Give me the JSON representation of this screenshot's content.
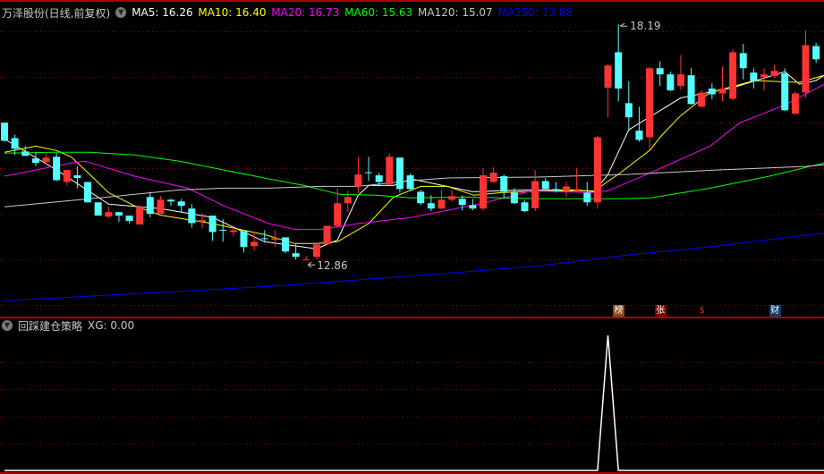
{
  "header": {
    "title": "万泽股份(日线,前复权)",
    "ma_labels": [
      {
        "text": "MA5: 16.26",
        "color": "#ffffff"
      },
      {
        "text": "MA10: 16.40",
        "color": "#ffff00"
      },
      {
        "text": "MA20: 16.73",
        "color": "#ff00ff"
      },
      {
        "text": "MA60: 15.63",
        "color": "#00ff00"
      },
      {
        "text": "MA120: 15.07",
        "color": "#c8c8c8"
      },
      {
        "text": "MA250: 13.88",
        "color": "#0000ff"
      }
    ]
  },
  "annotations": {
    "high_label": "18.19",
    "low_label": "12.86"
  },
  "event_markers": [
    {
      "index": 59,
      "text": "榜",
      "bg": "#8a4a10",
      "color": "#ffffff"
    },
    {
      "index": 63,
      "text": "张",
      "bg": "#7a0000",
      "color": "#ffffff"
    },
    {
      "index": 67,
      "text": "$",
      "bg": "transparent",
      "color": "#ff2020"
    },
    {
      "index": 74,
      "text": "财",
      "bg": "#103a6e",
      "color": "#ffffff"
    }
  ],
  "indicator": {
    "title": "回踩建仓策略",
    "value_label": "XG: 0.00"
  },
  "colors": {
    "up": "#ff3333",
    "down": "#54ffff",
    "grid": "#a00000",
    "border": "#b00000"
  },
  "chart_data": [
    {
      "type": "candlestick",
      "title": "万泽股份(日线,前复权)",
      "ylim": [
        11.63,
        18.74
      ],
      "grid": true,
      "ohlc": [
        [
          15.97,
          15.56,
          15.97,
          15.54
        ],
        [
          15.62,
          15.38,
          15.7,
          15.24
        ],
        [
          15.32,
          15.22,
          15.44,
          15.22
        ],
        [
          15.16,
          15.06,
          15.3,
          14.99
        ],
        [
          15.08,
          15.18,
          15.26,
          15.02
        ],
        [
          15.2,
          14.67,
          15.28,
          14.65
        ],
        [
          14.63,
          14.9,
          14.9,
          14.55
        ],
        [
          14.78,
          14.72,
          14.99,
          14.49
        ],
        [
          14.63,
          14.17,
          14.63,
          14.17
        ],
        [
          14.17,
          13.87,
          14.17,
          13.87
        ],
        [
          13.85,
          13.95,
          14.07,
          13.81
        ],
        [
          13.95,
          13.87,
          13.95,
          13.73
        ],
        [
          13.87,
          13.75,
          13.87,
          13.69
        ],
        [
          13.67,
          14.07,
          14.11,
          13.67
        ],
        [
          14.29,
          13.91,
          14.41,
          13.83
        ],
        [
          13.91,
          14.23,
          14.31,
          13.91
        ],
        [
          14.23,
          14.19,
          14.25,
          14.09
        ],
        [
          14.19,
          14.09,
          14.25,
          13.93
        ],
        [
          14.03,
          13.7,
          14.13,
          13.6
        ],
        [
          13.73,
          13.77,
          13.93,
          13.58
        ],
        [
          13.87,
          13.5,
          13.87,
          13.3
        ],
        [
          13.55,
          13.54,
          13.79,
          13.28
        ],
        [
          13.5,
          13.54,
          13.64,
          13.4
        ],
        [
          13.52,
          13.16,
          13.52,
          13.04
        ],
        [
          13.18,
          13.28,
          13.5,
          13.08
        ],
        [
          13.36,
          13.34,
          13.54,
          13.26
        ],
        [
          13.32,
          13.36,
          13.54,
          13.16
        ],
        [
          13.38,
          13.06,
          13.38,
          13.02
        ],
        [
          13.02,
          12.94,
          13.22,
          12.88
        ],
        [
          12.87,
          12.88,
          12.96,
          12.86
        ],
        [
          12.94,
          13.22,
          13.22,
          12.88
        ],
        [
          13.22,
          13.64,
          13.64,
          13.22
        ],
        [
          13.64,
          14.15,
          14.49,
          13.6
        ],
        [
          14.15,
          14.29,
          14.43,
          13.95
        ],
        [
          14.53,
          14.8,
          15.2,
          14.37
        ],
        [
          14.85,
          14.84,
          15.2,
          14.65
        ],
        [
          14.78,
          14.63,
          14.84,
          14.53
        ],
        [
          14.57,
          15.2,
          15.28,
          14.57
        ],
        [
          15.18,
          14.47,
          15.18,
          14.39
        ],
        [
          14.78,
          14.47,
          14.82,
          14.43
        ],
        [
          14.41,
          14.15,
          14.45,
          14.11
        ],
        [
          14.15,
          14.03,
          14.33,
          13.97
        ],
        [
          14.03,
          14.23,
          14.45,
          14.01
        ],
        [
          14.23,
          14.31,
          14.45,
          14.19
        ],
        [
          14.25,
          14.11,
          14.33,
          13.99
        ],
        [
          14.11,
          14.03,
          14.25,
          13.99
        ],
        [
          14.03,
          14.78,
          14.94,
          13.99
        ],
        [
          14.63,
          14.84,
          14.96,
          14.61
        ],
        [
          14.76,
          14.41,
          14.8,
          14.25
        ],
        [
          14.39,
          14.15,
          14.49,
          14.13
        ],
        [
          14.17,
          13.97,
          14.21,
          13.95
        ],
        [
          14.04,
          14.65,
          14.9,
          13.97
        ],
        [
          14.65,
          14.47,
          14.72,
          14.45
        ],
        [
          14.47,
          14.43,
          14.63,
          14.39
        ],
        [
          14.43,
          14.53,
          14.63,
          14.29
        ],
        [
          14.43,
          14.47,
          14.94,
          14.39
        ],
        [
          14.39,
          14.17,
          14.63,
          14.09
        ],
        [
          14.17,
          15.64,
          15.68,
          14.03
        ],
        [
          16.76,
          17.26,
          17.3,
          16.09
        ],
        [
          17.56,
          16.74,
          18.19,
          16.45
        ],
        [
          16.41,
          16.09,
          16.9,
          15.77
        ],
        [
          15.79,
          15.58,
          16.33,
          15.54
        ],
        [
          15.64,
          17.2,
          17.24,
          15.36
        ],
        [
          17.2,
          17.06,
          17.36,
          16.8
        ],
        [
          17.06,
          16.7,
          17.12,
          16.68
        ],
        [
          16.8,
          17.06,
          17.5,
          16.72
        ],
        [
          17.04,
          16.39,
          17.2,
          16.37
        ],
        [
          16.33,
          16.65,
          16.7,
          16.31
        ],
        [
          16.74,
          16.61,
          16.86,
          16.49
        ],
        [
          16.63,
          16.74,
          17.24,
          16.45
        ],
        [
          16.51,
          17.56,
          17.62,
          16.47
        ],
        [
          17.54,
          17.2,
          17.75,
          16.95
        ],
        [
          17.1,
          16.9,
          17.2,
          16.74
        ],
        [
          17.0,
          17.06,
          17.2,
          16.7
        ],
        [
          17.02,
          17.14,
          17.28,
          16.98
        ],
        [
          17.08,
          16.25,
          17.2,
          16.23
        ],
        [
          16.17,
          16.63,
          16.68,
          16.15
        ],
        [
          16.65,
          17.72,
          18.05,
          16.53
        ],
        [
          17.7,
          17.4,
          17.77,
          17.32
        ]
      ],
      "ma_series": [
        {
          "name": "MA5",
          "color": "#ffffff",
          "points": [
            [
              0,
              15.6
            ],
            [
              5,
              14.9
            ],
            [
              10,
              14.13
            ],
            [
              15,
              14.03
            ],
            [
              20,
              13.83
            ],
            [
              25,
              13.28
            ],
            [
              30,
              13.12
            ],
            [
              32,
              13.32
            ],
            [
              34,
              14.33
            ],
            [
              35,
              14.55
            ],
            [
              37.4,
              14.55
            ],
            [
              39.1,
              14.7
            ],
            [
              45,
              14.41
            ],
            [
              50,
              14.45
            ],
            [
              55,
              14.45
            ],
            [
              56.7,
              14.41
            ],
            [
              58,
              14.8
            ],
            [
              60,
              15.81
            ],
            [
              65,
              16.53
            ],
            [
              70,
              16.76
            ],
            [
              75,
              17.12
            ],
            [
              76.4,
              16.84
            ],
            [
              78,
              16.92
            ],
            [
              78.8,
              17.04
            ]
          ]
        },
        {
          "name": "MA10",
          "color": "#ffff00",
          "points": [
            [
              0,
              15.3
            ],
            [
              3,
              15.44
            ],
            [
              5,
              15.34
            ],
            [
              6.4,
              15.2
            ],
            [
              8.2,
              14.8
            ],
            [
              10,
              14.39
            ],
            [
              12.5,
              14.09
            ],
            [
              15,
              13.88
            ],
            [
              20,
              13.69
            ],
            [
              25,
              13.44
            ],
            [
              27.9,
              13.24
            ],
            [
              30,
              13.24
            ],
            [
              32,
              13.28
            ],
            [
              35,
              13.69
            ],
            [
              37.4,
              14.29
            ],
            [
              40,
              14.53
            ],
            [
              42.6,
              14.53
            ],
            [
              45.1,
              14.33
            ],
            [
              47.7,
              14.39
            ],
            [
              52,
              14.43
            ],
            [
              56.7,
              14.43
            ],
            [
              59.2,
              14.84
            ],
            [
              62.1,
              15.36
            ],
            [
              63,
              15.64
            ],
            [
              64.9,
              16.11
            ],
            [
              67.8,
              16.65
            ],
            [
              72.1,
              16.92
            ],
            [
              76.4,
              16.88
            ],
            [
              78.8,
              17.04
            ]
          ]
        },
        {
          "name": "MA20",
          "color": "#ff00ff",
          "points": [
            [
              0,
              14.76
            ],
            [
              6.4,
              15.06
            ],
            [
              7.7,
              15.1
            ],
            [
              12.5,
              14.76
            ],
            [
              17.6,
              14.49
            ],
            [
              21.1,
              14.09
            ],
            [
              25.4,
              13.69
            ],
            [
              27.9,
              13.56
            ],
            [
              30.5,
              13.56
            ],
            [
              34,
              13.69
            ],
            [
              39.1,
              13.83
            ],
            [
              46,
              14.15
            ],
            [
              50.6,
              14.43
            ],
            [
              56.3,
              14.39
            ],
            [
              58,
              14.43
            ],
            [
              62.1,
              14.84
            ],
            [
              67.8,
              15.44
            ],
            [
              70.7,
              15.97
            ],
            [
              75,
              16.37
            ],
            [
              78.8,
              16.84
            ]
          ]
        },
        {
          "name": "MA60",
          "color": "#00ff00",
          "points": [
            [
              0,
              15.28
            ],
            [
              4.7,
              15.3
            ],
            [
              8.2,
              15.3
            ],
            [
              12.5,
              15.24
            ],
            [
              16.8,
              15.1
            ],
            [
              21.1,
              14.9
            ],
            [
              25.4,
              14.7
            ],
            [
              28.8,
              14.55
            ],
            [
              32.2,
              14.35
            ],
            [
              35.7,
              14.33
            ],
            [
              39.1,
              14.27
            ],
            [
              44.3,
              14.29
            ],
            [
              51.2,
              14.25
            ],
            [
              56.3,
              14.25
            ],
            [
              59.2,
              14.25
            ],
            [
              62.1,
              14.27
            ],
            [
              67.8,
              14.49
            ],
            [
              73.5,
              14.76
            ],
            [
              78.8,
              15.06
            ]
          ]
        },
        {
          "name": "MA120",
          "color": "#c8c8c8",
          "points": [
            [
              0,
              14.07
            ],
            [
              8.2,
              14.25
            ],
            [
              16.8,
              14.45
            ],
            [
              21.1,
              14.49
            ],
            [
              25.4,
              14.49
            ],
            [
              30.5,
              14.53
            ],
            [
              34,
              14.53
            ],
            [
              39.1,
              14.66
            ],
            [
              42.6,
              14.72
            ],
            [
              51.2,
              14.74
            ],
            [
              59.8,
              14.8
            ],
            [
              68.4,
              14.9
            ],
            [
              77,
              14.98
            ],
            [
              78.8,
              15.02
            ]
          ]
        },
        {
          "name": "MA250",
          "color": "#0000ff",
          "points": [
            [
              0,
              11.95
            ],
            [
              25.4,
              12.27
            ],
            [
              42.6,
              12.57
            ],
            [
              51.2,
              12.73
            ],
            [
              59.8,
              12.98
            ],
            [
              68.4,
              13.18
            ],
            [
              78.8,
              13.48
            ]
          ]
        }
      ],
      "high_point": {
        "index": 59,
        "value": 18.19
      },
      "low_point": {
        "index": 29,
        "value": 12.86
      }
    },
    {
      "type": "line",
      "title": "回踩建仓策略",
      "series": [
        {
          "name": "XG",
          "color": "#ffffff",
          "spikes": [
            [
              58,
              1
            ]
          ]
        }
      ],
      "ylim": [
        0,
        1
      ],
      "count": 79
    }
  ]
}
